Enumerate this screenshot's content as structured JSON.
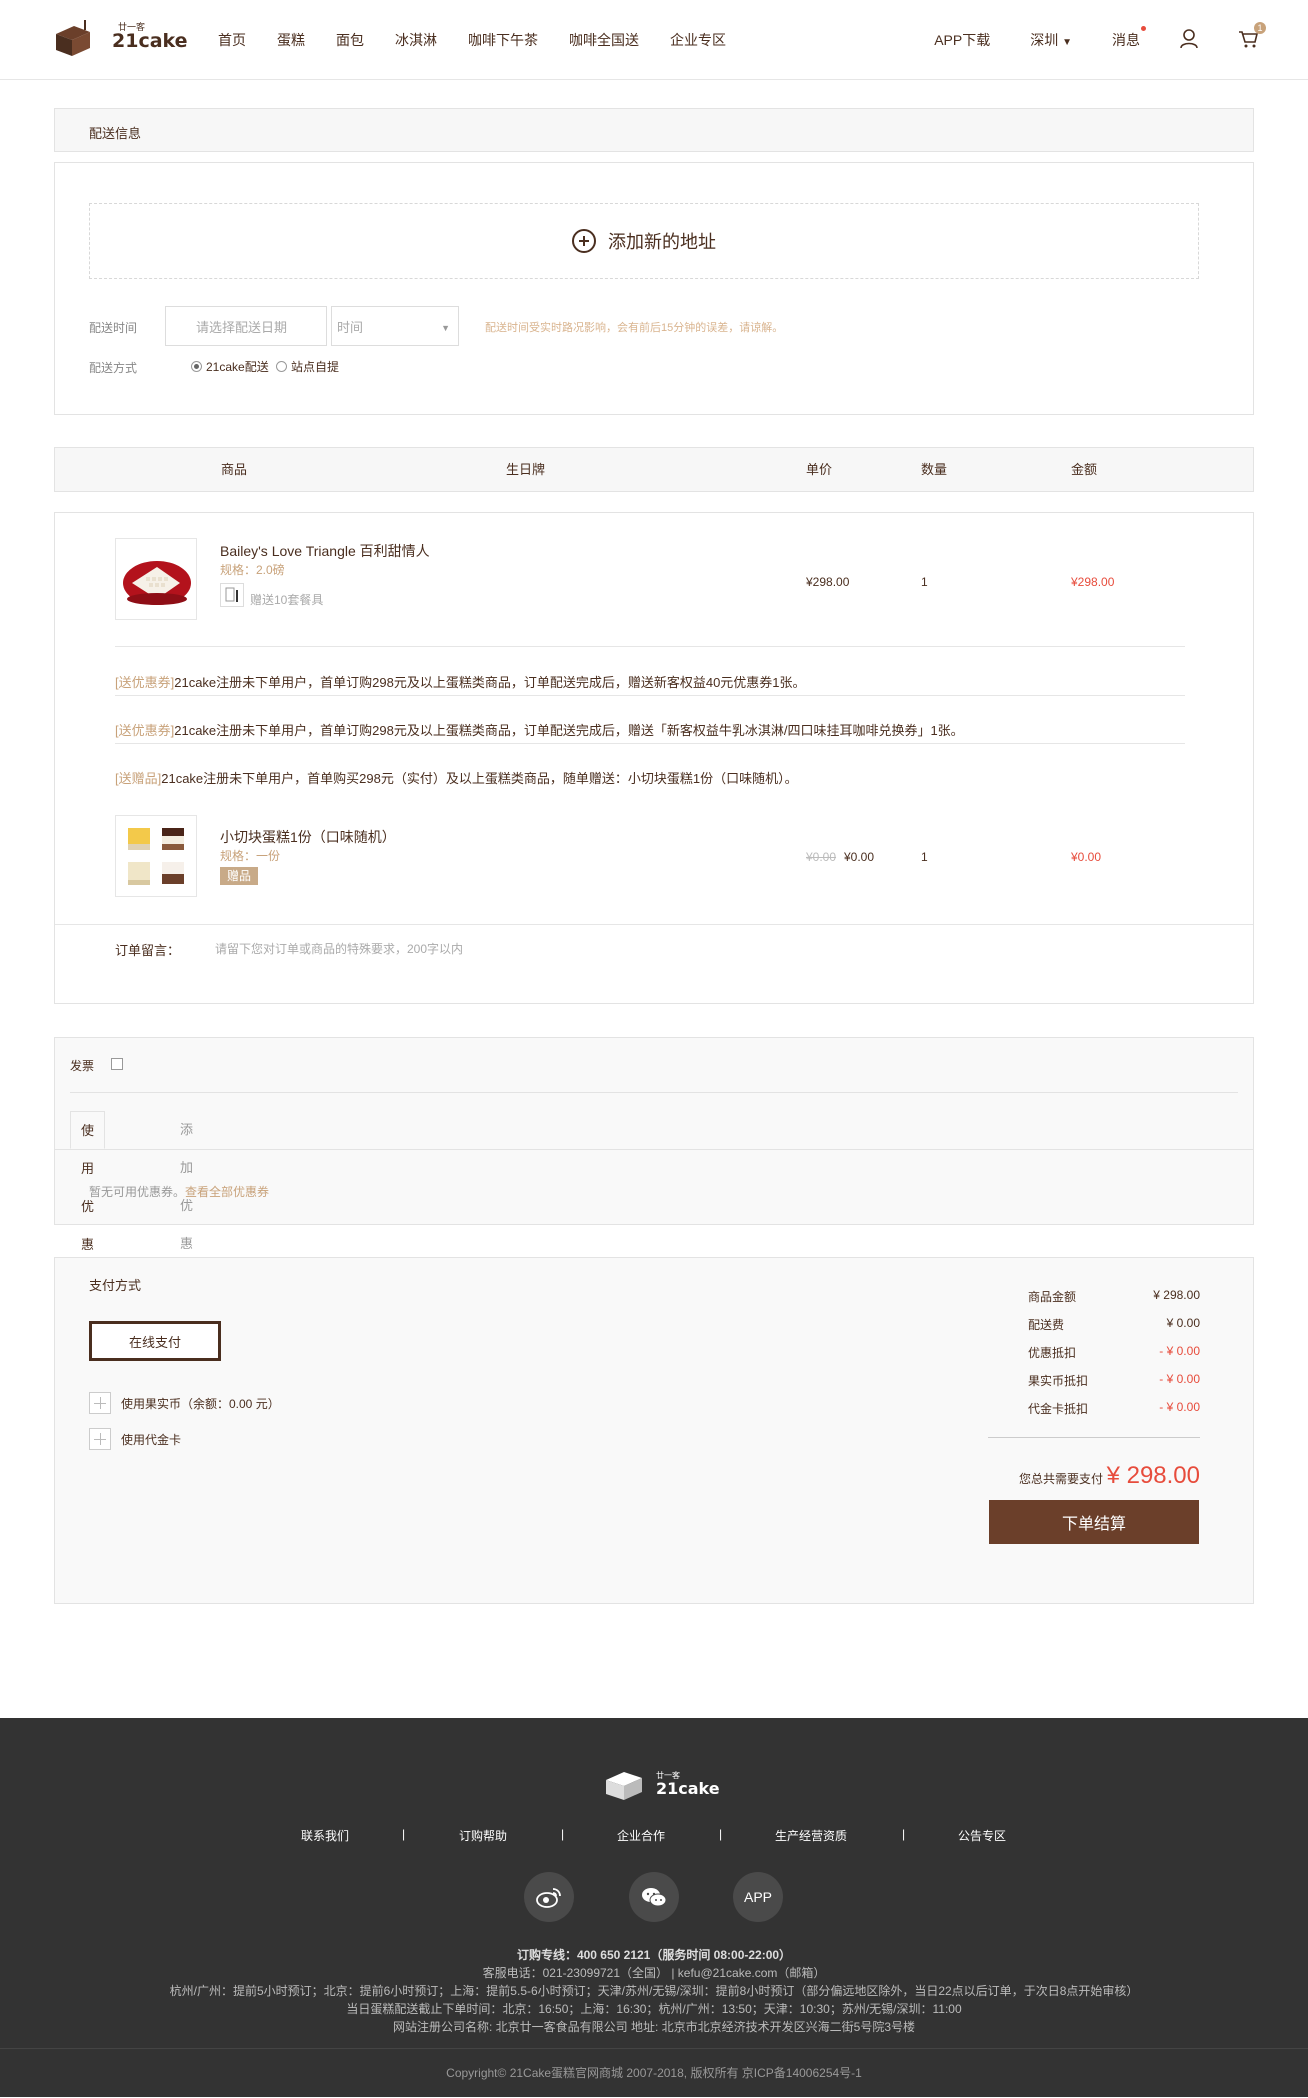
{
  "header": {
    "logo_text": "21cake",
    "logo_small": "廿一客",
    "nav": [
      "首页",
      "蛋糕",
      "面包",
      "冰淇淋",
      "咖啡下午茶",
      "咖啡全国送",
      "企业专区"
    ],
    "app_download": "APP下载",
    "city": "深圳",
    "messages": "消息",
    "cart_count": "1"
  },
  "delivery": {
    "section_title": "配送信息",
    "add_address": "添加新的地址",
    "time_label": "配送时间",
    "date_placeholder": "请选择配送日期",
    "time_placeholder": "时间",
    "time_note": "配送时间受实时路况影响，会有前后15分钟的误差，请谅解。",
    "method_label": "配送方式",
    "method_options": [
      "21cake配送",
      "站点自提"
    ]
  },
  "order_table": {
    "headers": [
      "商品",
      "生日牌",
      "单价",
      "数量",
      "金额"
    ],
    "items": [
      {
        "name": "Bailey's Love Triangle 百利甜情人",
        "spec": "规格：2.0磅",
        "gift_note": "赠送10套餐具",
        "price": "¥298.00",
        "qty": "1",
        "amount": "¥298.00"
      }
    ],
    "promotions": [
      {
        "tag": "[送优惠券]",
        "text": "21cake注册未下单用户，首单订购298元及以上蛋糕类商品，订单配送完成后，赠送新客权益40元优惠券1张。"
      },
      {
        "tag": "[送优惠券]",
        "text": "21cake注册未下单用户，首单订购298元及以上蛋糕类商品，订单配送完成后，赠送「新客权益牛乳冰淇淋/四口味挂耳咖啡兑换券」1张。"
      },
      {
        "tag": "[送赠品]",
        "text": "21cake注册未下单用户，首单购买298元（实付）及以上蛋糕类商品，随单赠送：小切块蛋糕1份（口味随机）。"
      }
    ],
    "gift_item": {
      "name": "小切块蛋糕1份（口味随机）",
      "spec": "规格：一份",
      "badge": "赠品",
      "original_price": "¥0.00",
      "price": "¥0.00",
      "qty": "1",
      "amount": "¥0.00"
    },
    "remark_label": "订单留言：",
    "remark_placeholder": "请留下您对订单或商品的特殊要求，200字以内"
  },
  "invoice": {
    "label": "发票",
    "tabs": [
      "使用优惠券",
      "添加优惠券/尊享卡"
    ],
    "no_coupon": "暂无可用优惠券。",
    "view_all": "查看全部优惠券"
  },
  "payment": {
    "title": "支付方式",
    "online": "在线支付",
    "fruit_coin": "使用果实币（余额：0.00 元）",
    "voucher": "使用代金卡",
    "summary": [
      {
        "k": "商品金额",
        "v": "¥ 298.00",
        "red": false
      },
      {
        "k": "配送费",
        "v": "¥ 0.00",
        "red": false
      },
      {
        "k": "优惠抵扣",
        "v": "- ¥ 0.00",
        "red": true
      },
      {
        "k": "果实币抵扣",
        "v": "- ¥ 0.00",
        "red": true
      },
      {
        "k": "代金卡抵扣",
        "v": "- ¥ 0.00",
        "red": true
      }
    ],
    "total_label": "您总共需要支付",
    "total": "¥ 298.00",
    "submit": "下单结算"
  },
  "footer": {
    "links": [
      "联系我们",
      "订购帮助",
      "企业合作",
      "生产经营资质",
      "公告专区"
    ],
    "social": [
      "weibo",
      "wechat",
      "APP"
    ],
    "hotline": "订购专线：400 650 2121（服务时间 08:00-22:00）",
    "service": "客服电话：021-23099721（全国） | kefu@21cake.com（邮箱）",
    "advance": "杭州/广州：提前5小时预订；北京：提前6小时预订；上海：提前5.5-6小时预订；天津/苏州/无锡/深圳：提前8小时预订（部分偏远地区除外，当日22点以后订单，于次日8点开始审核）",
    "cutoff": "当日蛋糕配送截止下单时间：北京：16:50；上海：16:30；杭州/广州：13:50；天津：10:30；苏州/无锡/深圳：11:00",
    "company": "网站注册公司名称: 北京廿一客食品有限公司 地址: 北京市北京经济技术开发区兴海二街5号院3号楼",
    "copyright": "Copyright© 21Cake蛋糕官网商城 2007-2018, 版权所有 京ICP备14006254号-1"
  }
}
